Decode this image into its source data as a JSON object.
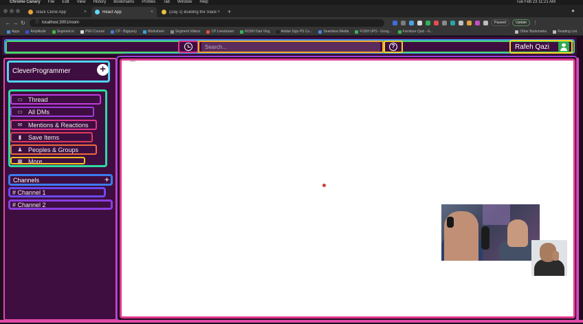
{
  "mac_menu": {
    "items": [
      "Chrome Canary",
      "File",
      "Edit",
      "View",
      "History",
      "Bookmarks",
      "Profiles",
      "Tab",
      "Window",
      "Help"
    ],
    "clock": "Tue Feb 23 11:21 AM"
  },
  "browser": {
    "tabs": [
      {
        "label": "Slack Clone App",
        "favicon_color": "#e8a33d"
      },
      {
        "label": "React App",
        "favicon_color": "#61dafb"
      },
      {
        "label": "(Day 2) Building the Slack Clo",
        "favicon_color": "#e8c13d"
      }
    ],
    "new_tab": "+",
    "url": "localhost:3001/room",
    "profile_status": "Paused",
    "update_label": "Update",
    "bookmarks": [
      "Apps",
      "Amplitude",
      "Segment.io",
      "PWJ Course",
      "CP - Bigquery",
      "Worksheet",
      "Segment Videos",
      "CP Livestream",
      "ROSH Dad Vlog",
      "Adobe Sign PS Co...",
      "Seamless Media",
      "FUSH UPS - Goog...",
      "Furniture Qazi - G..."
    ],
    "bookmarks_right": [
      "Other Bookmarks",
      "Reading List"
    ]
  },
  "header": {
    "search_placeholder": "Search...",
    "user_name": "Rafeh Qazi"
  },
  "sidebar": {
    "workspace_name": "CleverProgrammer",
    "add_icon": "+",
    "items": [
      {
        "label": "Thread",
        "icon": "message-icon",
        "glyph": "▭",
        "color": "#c03ee0"
      },
      {
        "label": "All DMs",
        "icon": "inbox-icon",
        "glyph": "▭",
        "color": "#a03ee0"
      },
      {
        "label": "Mentions & Reactions",
        "icon": "drafts-icon",
        "glyph": "✉",
        "color": "#e0368c"
      },
      {
        "label": "Save Items",
        "icon": "bookmark-icon",
        "glyph": "▮",
        "color": "#e03c5a"
      },
      {
        "label": "Peoples & Groups",
        "icon": "people-icon",
        "glyph": "♟",
        "color": "#f06a3c"
      },
      {
        "label": "More",
        "icon": "apps-icon",
        "glyph": "▦",
        "color": "#f5c023"
      }
    ],
    "channels_label": "Channels",
    "channels_add": "+",
    "channels": [
      {
        "label": "# Channel 1",
        "color": "#6a4af0"
      },
      {
        "label": "# Channel 2",
        "color": "#8b3ee0"
      }
    ]
  },
  "colors": {
    "slack_purple": "#3f0e40",
    "main_bg": "#ffffff",
    "status_green": "#2fa84f"
  }
}
